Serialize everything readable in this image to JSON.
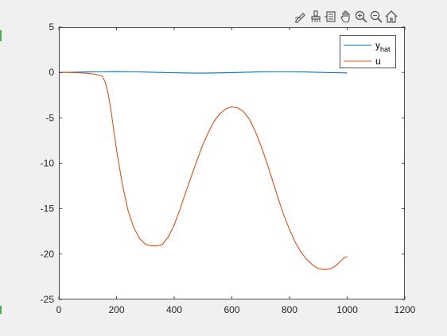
{
  "toolbar": {
    "buttons": [
      {
        "name": "edit-plot-icon"
      },
      {
        "name": "brush-icon"
      },
      {
        "name": "data-tips-icon"
      },
      {
        "name": "pan-hand-icon"
      },
      {
        "name": "zoom-in-icon"
      },
      {
        "name": "zoom-out-icon"
      },
      {
        "name": "home-icon"
      }
    ]
  },
  "colors": {
    "series_1": "#0072BD",
    "series_2": "#D95319",
    "axes_bg": "#ffffff",
    "figure_bg": "#f0f0f0",
    "axis_line": "#262626"
  },
  "chart_data": {
    "type": "line",
    "title": "",
    "xlabel": "",
    "ylabel": "",
    "xlim": [
      0,
      1200
    ],
    "ylim": [
      -25,
      5
    ],
    "xticks": [
      0,
      200,
      400,
      600,
      800,
      1000,
      1200
    ],
    "yticks": [
      5,
      0,
      -5,
      -10,
      -15,
      -20,
      -25
    ],
    "xtick_labels": [
      "0",
      "200",
      "400",
      "600",
      "800",
      "1000",
      "1200"
    ],
    "ytick_labels": [
      "5",
      "0",
      "-5",
      "-10",
      "-15",
      "-20",
      "-25"
    ],
    "grid": false,
    "legend_position": "top-right",
    "legend": [
      {
        "base": "y",
        "sub": "hat"
      },
      {
        "base": "u",
        "sub": ""
      }
    ],
    "series": [
      {
        "name": "y_hat",
        "color": "#0072BD",
        "x": [
          0,
          50,
          100,
          150,
          200,
          250,
          300,
          350,
          400,
          450,
          500,
          550,
          600,
          650,
          700,
          750,
          800,
          850,
          900,
          950,
          1000
        ],
        "y": [
          0,
          0.02,
          0.05,
          0.08,
          0.1,
          0.08,
          0.04,
          0.0,
          -0.04,
          -0.07,
          -0.08,
          -0.06,
          -0.02,
          0.02,
          0.06,
          0.08,
          0.08,
          0.05,
          0.01,
          -0.03,
          -0.06
        ]
      },
      {
        "name": "u",
        "color": "#D95319",
        "x": [
          0,
          25,
          50,
          75,
          100,
          125,
          150,
          160,
          170,
          180,
          190,
          200,
          220,
          240,
          260,
          280,
          300,
          320,
          340,
          350,
          360,
          380,
          400,
          420,
          440,
          460,
          480,
          500,
          520,
          540,
          560,
          580,
          600,
          620,
          640,
          660,
          680,
          700,
          720,
          740,
          760,
          780,
          800,
          820,
          840,
          860,
          880,
          900,
          920,
          940,
          950,
          960,
          970,
          980,
          990,
          1000
        ],
        "y": [
          0,
          0,
          -0.02,
          -0.05,
          -0.1,
          -0.2,
          -0.4,
          -1.0,
          -2.2,
          -4.0,
          -6.3,
          -8.5,
          -12.3,
          -15.2,
          -17.1,
          -18.3,
          -18.9,
          -19.1,
          -19.1,
          -19.05,
          -18.9,
          -18.1,
          -16.8,
          -15.1,
          -13.2,
          -11.4,
          -9.6,
          -7.9,
          -6.5,
          -5.3,
          -4.5,
          -4.0,
          -3.8,
          -3.9,
          -4.3,
          -5.1,
          -6.4,
          -8.0,
          -9.8,
          -11.8,
          -13.8,
          -15.7,
          -17.3,
          -18.7,
          -19.8,
          -20.6,
          -21.2,
          -21.6,
          -21.7,
          -21.65,
          -21.5,
          -21.3,
          -21.0,
          -20.7,
          -20.4,
          -20.3
        ]
      }
    ]
  }
}
